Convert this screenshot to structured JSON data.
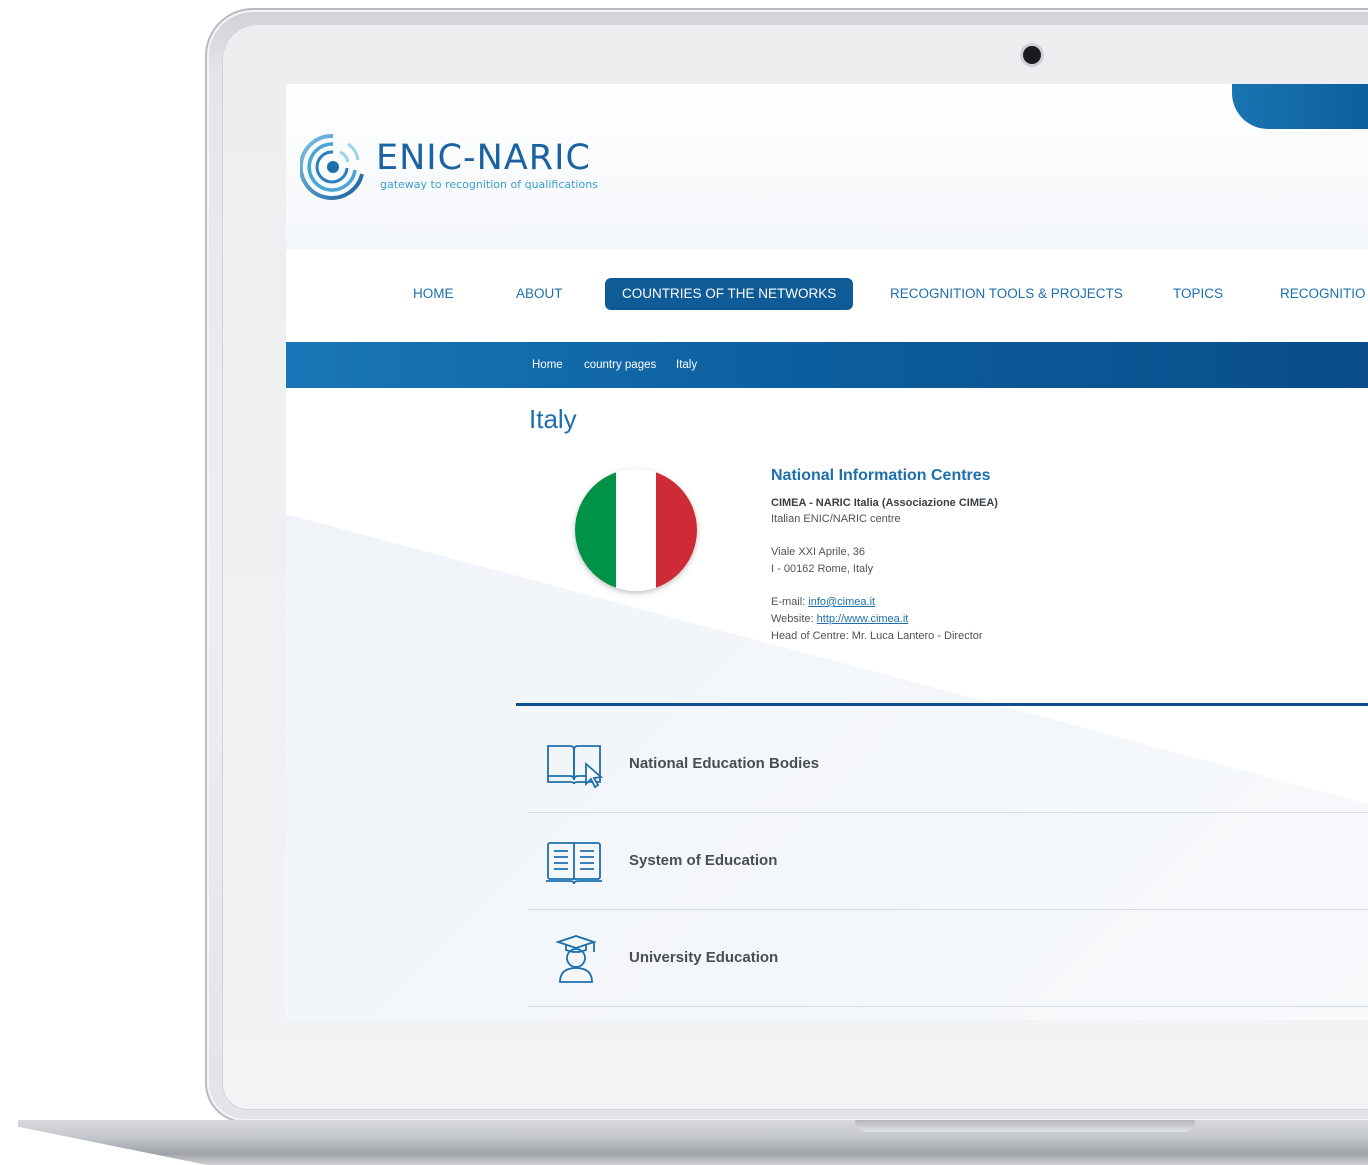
{
  "logo": {
    "title": "ENIC-NARIC",
    "tagline": "gateway to recognition of qualifications"
  },
  "nav": {
    "items": [
      {
        "label": "HOME"
      },
      {
        "label": "ABOUT"
      },
      {
        "label": "COUNTRIES OF THE NETWORKS",
        "active": true
      },
      {
        "label": "RECOGNITION TOOLS & PROJECTS"
      },
      {
        "label": "TOPICS"
      },
      {
        "label": "RECOGNITIO"
      }
    ]
  },
  "breadcrumb": [
    "Home",
    "country pages",
    "Italy"
  ],
  "page": {
    "title": "Italy"
  },
  "nic": {
    "heading": "National Information Centres",
    "org_name": "CIMEA - NARIC Italia (Associazione CIMEA)",
    "org_desc": "Italian ENIC/NARIC centre",
    "address_1": "Viale XXI Aprile, 36",
    "address_2": "I - 00162 Rome, Italy",
    "email_label": "E-mail: ",
    "email": "info@cimea.it",
    "website_label": "Website: ",
    "website": "http://www.cimea.it",
    "head": "Head of Centre: Mr. Luca Lantero - Director"
  },
  "sections": [
    {
      "label": "National Education Bodies",
      "icon": "book-cursor-icon"
    },
    {
      "label": "System of Education",
      "icon": "open-book-icon"
    },
    {
      "label": "University Education",
      "icon": "graduate-icon"
    }
  ],
  "colors": {
    "brand_blue": "#1e6fae",
    "nav_active": "#0e5b97",
    "flag_green": "#009246",
    "flag_white": "#ffffff",
    "flag_red": "#ce2b37"
  }
}
